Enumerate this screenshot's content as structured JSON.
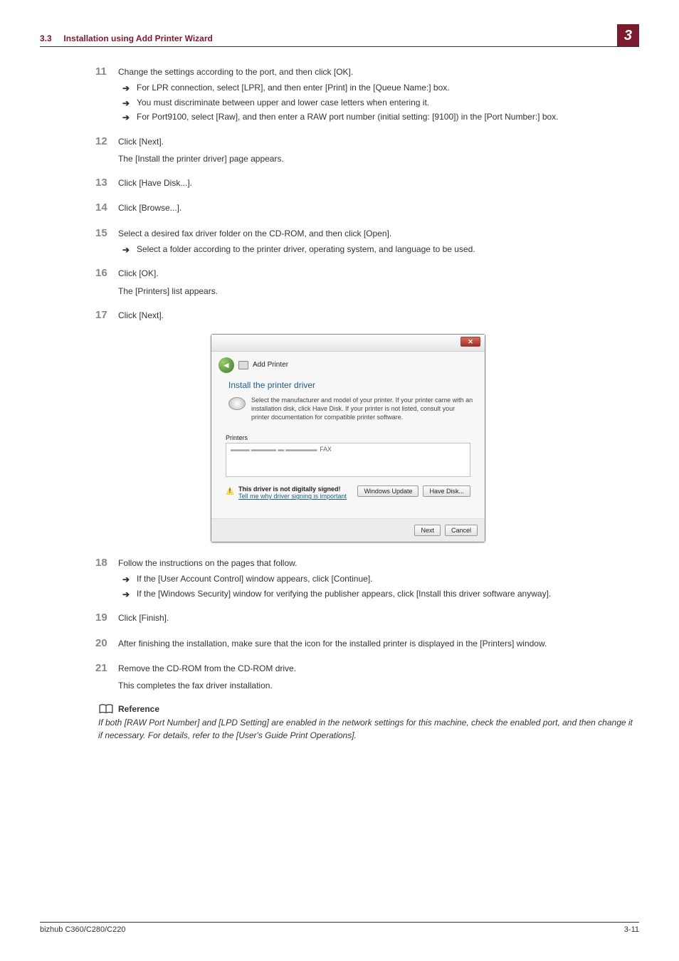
{
  "header": {
    "section_num": "3.3",
    "section_title": "Installation using Add Printer Wizard",
    "chapter_num": "3"
  },
  "steps": [
    {
      "num": "11",
      "text": "Change the settings according to the port, and then click [OK].",
      "subs": [
        "For LPR connection, select [LPR], and then enter [Print] in the [Queue Name:] box.",
        "You must discriminate between upper and lower case letters when entering it.",
        "For Port9100, select [Raw], and then enter a RAW port number (initial setting: [9100]) in the [Port Number:] box."
      ]
    },
    {
      "num": "12",
      "text": "Click [Next].",
      "desc": "The [Install the printer driver] page appears."
    },
    {
      "num": "13",
      "text": "Click [Have Disk...]."
    },
    {
      "num": "14",
      "text": "Click [Browse...]."
    },
    {
      "num": "15",
      "text": "Select a desired fax driver folder on the CD-ROM, and then click [Open].",
      "subs": [
        "Select a folder according to the printer driver, operating system, and language to be used."
      ]
    },
    {
      "num": "16",
      "text": "Click [OK].",
      "desc": "The [Printers] list appears."
    },
    {
      "num": "17",
      "text": "Click [Next]."
    }
  ],
  "dialog": {
    "breadcrumb": "Add Printer",
    "title": "Install the printer driver",
    "info": "Select the manufacturer and model of your printer. If your printer came with an installation disk, click Have Disk. If your printer is not listed, consult your printer documentation for compatible printer software.",
    "printers_label": "Printers",
    "printer_item": "FAX",
    "warn_title": "This driver is not digitally signed!",
    "warn_link": "Tell me why driver signing is important",
    "btn_update": "Windows Update",
    "btn_have_disk": "Have Disk...",
    "btn_next": "Next",
    "btn_cancel": "Cancel"
  },
  "steps2": [
    {
      "num": "18",
      "text": "Follow the instructions on the pages that follow.",
      "subs": [
        "If the [User Account Control] window appears, click [Continue].",
        "If the [Windows Security] window for verifying the publisher appears, click [Install this driver software anyway]."
      ]
    },
    {
      "num": "19",
      "text": "Click [Finish]."
    },
    {
      "num": "20",
      "text": "After finishing the installation, make sure that the icon for the installed printer is displayed in the [Printers] window."
    },
    {
      "num": "21",
      "text": "Remove the CD-ROM from the CD-ROM drive.",
      "desc": "This completes the fax driver installation."
    }
  ],
  "reference": {
    "title": "Reference",
    "text": "If both [RAW Port Number] and [LPD Setting] are enabled in the network settings for this machine, check the enabled port, and then change it if necessary. For details, refer to the [User's Guide Print Operations]."
  },
  "footer": {
    "left": "bizhub C360/C280/C220",
    "right": "3-11"
  }
}
